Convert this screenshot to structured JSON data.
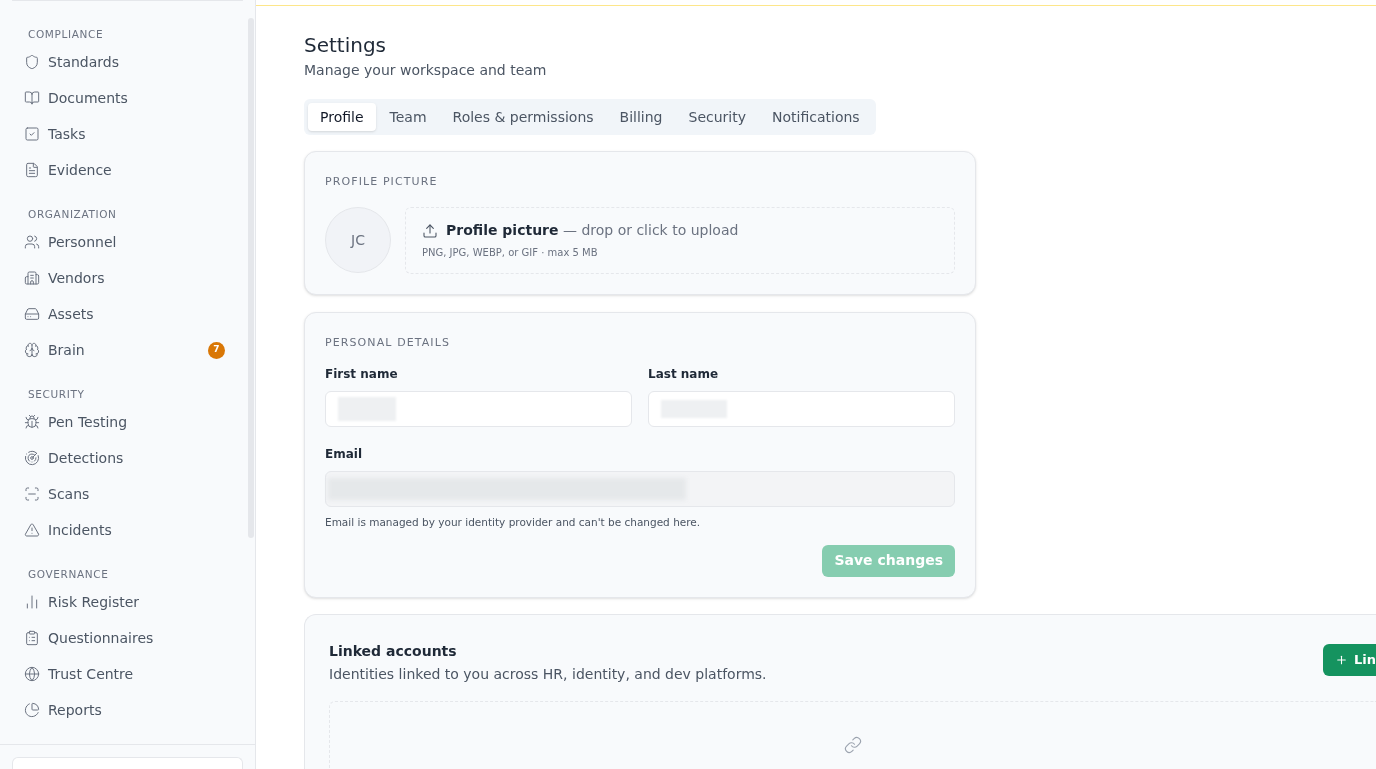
{
  "sidebar": {
    "sections": [
      {
        "title": "COMPLIANCE",
        "items": [
          {
            "label": "Standards"
          },
          {
            "label": "Documents"
          },
          {
            "label": "Tasks"
          },
          {
            "label": "Evidence"
          }
        ]
      },
      {
        "title": "ORGANIZATION",
        "items": [
          {
            "label": "Personnel"
          },
          {
            "label": "Vendors"
          },
          {
            "label": "Assets"
          },
          {
            "label": "Brain",
            "badge": "7"
          }
        ]
      },
      {
        "title": "SECURITY",
        "items": [
          {
            "label": "Pen Testing"
          },
          {
            "label": "Detections"
          },
          {
            "label": "Scans"
          },
          {
            "label": "Incidents"
          }
        ]
      },
      {
        "title": "GOVERNANCE",
        "items": [
          {
            "label": "Risk Register"
          },
          {
            "label": "Questionnaires"
          },
          {
            "label": "Trust Centre"
          },
          {
            "label": "Reports"
          }
        ]
      }
    ]
  },
  "page": {
    "title": "Settings",
    "subtitle": "Manage your workspace and team"
  },
  "tabs": [
    {
      "label": "Profile",
      "selected": true
    },
    {
      "label": "Team",
      "selected": false
    },
    {
      "label": "Roles & permissions",
      "selected": false
    },
    {
      "label": "Billing",
      "selected": false
    },
    {
      "label": "Security",
      "selected": false
    },
    {
      "label": "Notifications",
      "selected": false
    }
  ],
  "profile_picture": {
    "heading": "PROFILE PICTURE",
    "initials": "JC",
    "upload_label": "**Profile picture** — drop or click to upload",
    "upload_hint": "PNG, JPG, WEBP, or GIF · max 5 MB"
  },
  "personal_details": {
    "heading": "PERSONAL DETAILS",
    "first_name_label": "First name",
    "last_name_label": "Last name",
    "email_label": "Email",
    "email_disabled": true,
    "email_help": "Email is managed by your identity provider and can't be changed here.",
    "save_button": {
      "label": "Save changes",
      "disabled": true
    }
  },
  "linked_accounts": {
    "title": "Linked accounts",
    "subtitle": "Identities linked to you across HR, identity, and dev platforms.",
    "button": "Lin"
  }
}
